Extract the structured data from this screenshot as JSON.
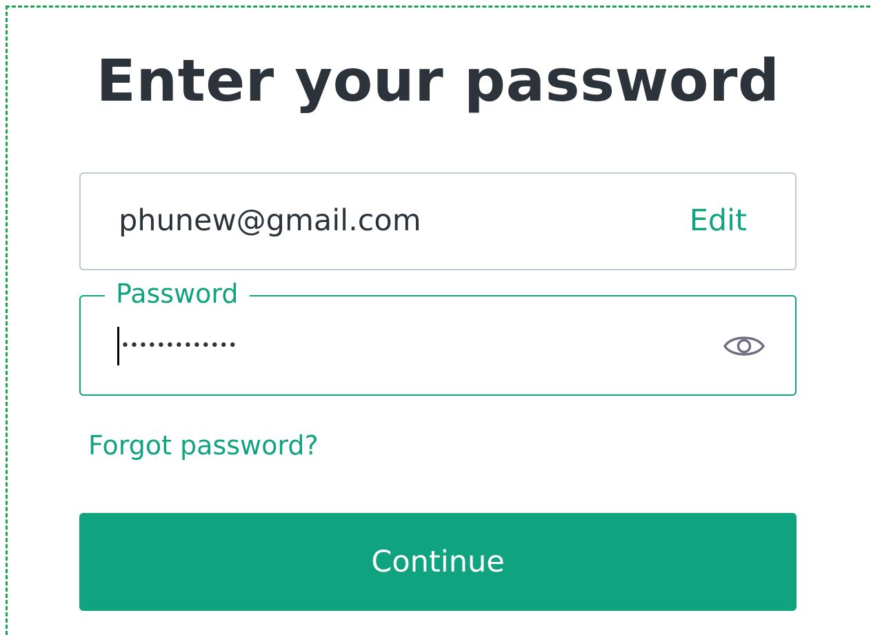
{
  "title": "Enter your password",
  "email": {
    "value": "phunew@gmail.com",
    "edit_label": "Edit"
  },
  "password": {
    "label": "Password",
    "value": "•••••••••••••",
    "toggle_icon": "eye-icon"
  },
  "forgot_password_label": "Forgot password?",
  "continue_label": "Continue",
  "colors": {
    "accent": "#10a37f",
    "text": "#2d333a",
    "border": "#c2c8d0",
    "frame": "#1ea34f"
  }
}
